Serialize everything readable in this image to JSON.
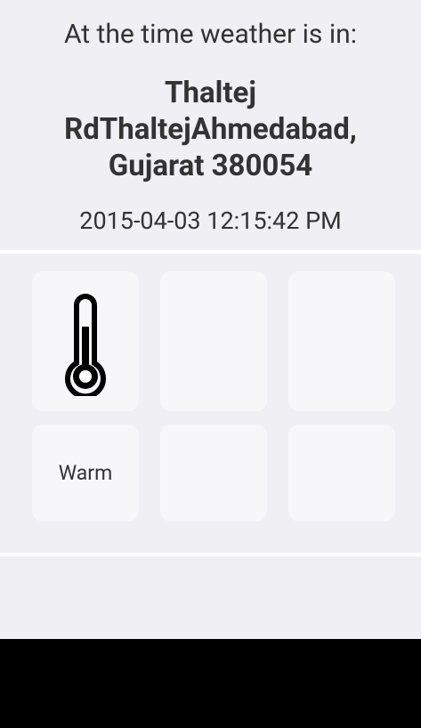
{
  "header": {
    "intro": "At the time weather is in:",
    "location_line1": "Thaltej",
    "location_line2": "RdThaltejAhmedabad,",
    "location_line3": "Gujarat 380054",
    "datetime": "2015-04-03 12:15:42 PM"
  },
  "tiles": {
    "row1": [
      {
        "icon": "thermometer-icon"
      },
      {
        "icon": ""
      },
      {
        "icon": ""
      }
    ],
    "row2": [
      {
        "label": "Warm"
      },
      {
        "label": ""
      },
      {
        "label": ""
      }
    ]
  },
  "colors": {
    "background": "#f0eff4",
    "tile": "#f7f7f9",
    "divider": "#ffffff",
    "text": "#333333",
    "nav_bar": "#000000"
  }
}
